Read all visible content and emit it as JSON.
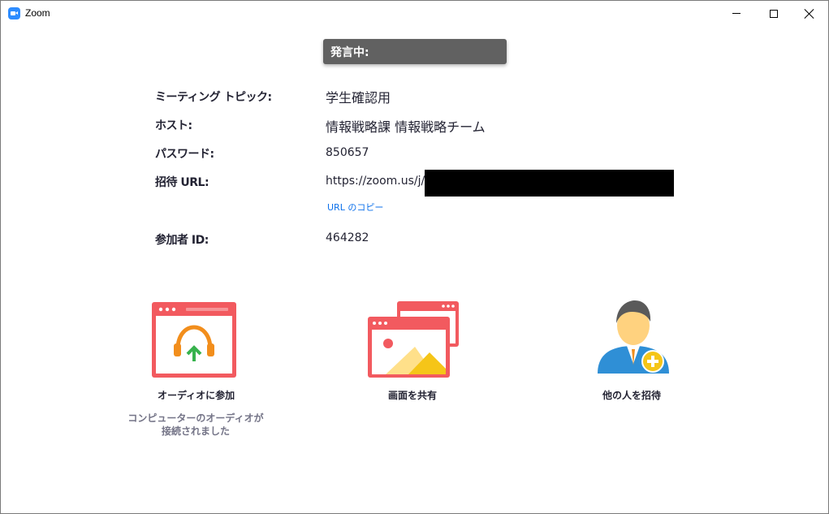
{
  "window": {
    "title": "Zoom"
  },
  "banner": {
    "speaking_label": "発言中:"
  },
  "info": {
    "topic_label": "ミーティング トピック:",
    "topic_value": "学生確認用",
    "host_label": "ホスト:",
    "host_value": "情報戦略課 情報戦略チーム",
    "password_label": "パスワード:",
    "password_value": "850657",
    "url_label": "招待 URL:",
    "url_value": "https://zoom.us/j/",
    "copy_url_label": "URL のコピー",
    "participant_label": "参加者 ID:",
    "participant_value": "464282"
  },
  "actions": {
    "join_audio_label": "オーディオに参加",
    "audio_status_line1": "コンピューターのオーディオが",
    "audio_status_line2": "接続されました",
    "share_screen_label": "画面を共有",
    "invite_label": "他の人を招待"
  },
  "colors": {
    "accent_red": "#f25a5f",
    "link_blue": "#0e71eb",
    "banner_gray": "#616161",
    "headset_orange": "#f28e1c",
    "arrow_green": "#37b24d",
    "avatar_blue": "#2f8fd6",
    "avatar_skin": "#ffd27f",
    "plus_yellow": "#f5c518"
  },
  "icons": {
    "app": "zoom-camera-icon",
    "join_audio": "headset-upload-icon",
    "share_screen": "share-picture-windows-icon",
    "invite": "person-add-icon"
  }
}
